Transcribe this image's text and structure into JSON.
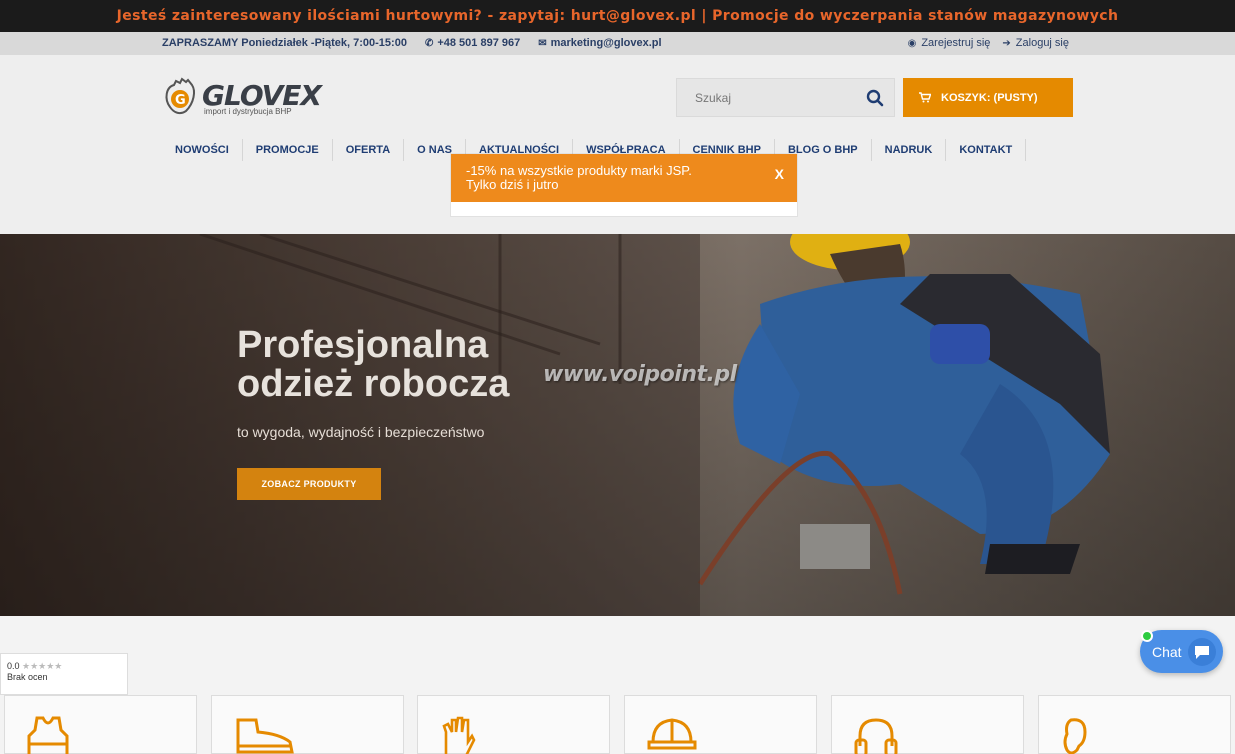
{
  "top_banner": {
    "text": "Jesteś zainteresowany ilościami hurtowymi? - zapytaj: hurt@glovex.pl | Promocje do wyczerpania stanów magazynowych"
  },
  "info_bar": {
    "hours": "ZAPRASZAMY Poniedziałek -Piątek, 7:00-15:00",
    "phone": "+48 501 897 967",
    "email": "marketing@glovex.pl",
    "register": "Zarejestruj się",
    "login": "Zaloguj się"
  },
  "logo": {
    "name": "GLOVEX",
    "tagline": "import i dystrybucja BHP"
  },
  "search": {
    "placeholder": "Szukaj"
  },
  "cart": {
    "label": "KOSZYK: (PUSTY)"
  },
  "nav": {
    "items": [
      "NOWOŚCI",
      "PROMOCJE",
      "OFERTA",
      "O NAS",
      "AKTUALNOŚCI",
      "WSPÓŁPRACA",
      "CENNIK BHP",
      "BLOG O BHP",
      "NADRUK",
      "KONTAKT"
    ]
  },
  "popup": {
    "line1": "-15% na wszystkie produkty marki JSP.",
    "line2": "Tylko dziś i jutro",
    "close": "X"
  },
  "hero": {
    "title": "Profesjonalna odzież robocza",
    "subtitle": "to wygoda, wydajność i bezpieczeństwo",
    "cta": "ZOBACZ PRODUKTY",
    "watermark": "www.voipoint.pl"
  },
  "rating_widget": {
    "score": "0.0",
    "stars": "★★★★★",
    "text": "Brak ocen"
  },
  "chat": {
    "label": "Chat"
  },
  "categories": {
    "icons": [
      "vest-icon",
      "shoe-icon",
      "glove-icon",
      "helmet-icon",
      "ear-protection-icon",
      "earplug-icon"
    ]
  },
  "colors": {
    "accent": "#e58a00",
    "nav_text": "#1f3d73",
    "banner_text": "#e8662b"
  }
}
